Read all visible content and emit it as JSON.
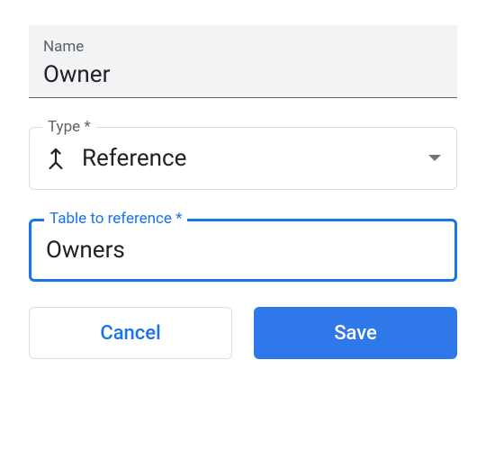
{
  "name_field": {
    "label": "Name",
    "value": "Owner"
  },
  "type_field": {
    "label": "Type *",
    "value": "Reference",
    "icon": "merge-icon"
  },
  "ref_field": {
    "label": "Table to reference *",
    "value": "Owners"
  },
  "buttons": {
    "cancel": "Cancel",
    "save": "Save"
  }
}
